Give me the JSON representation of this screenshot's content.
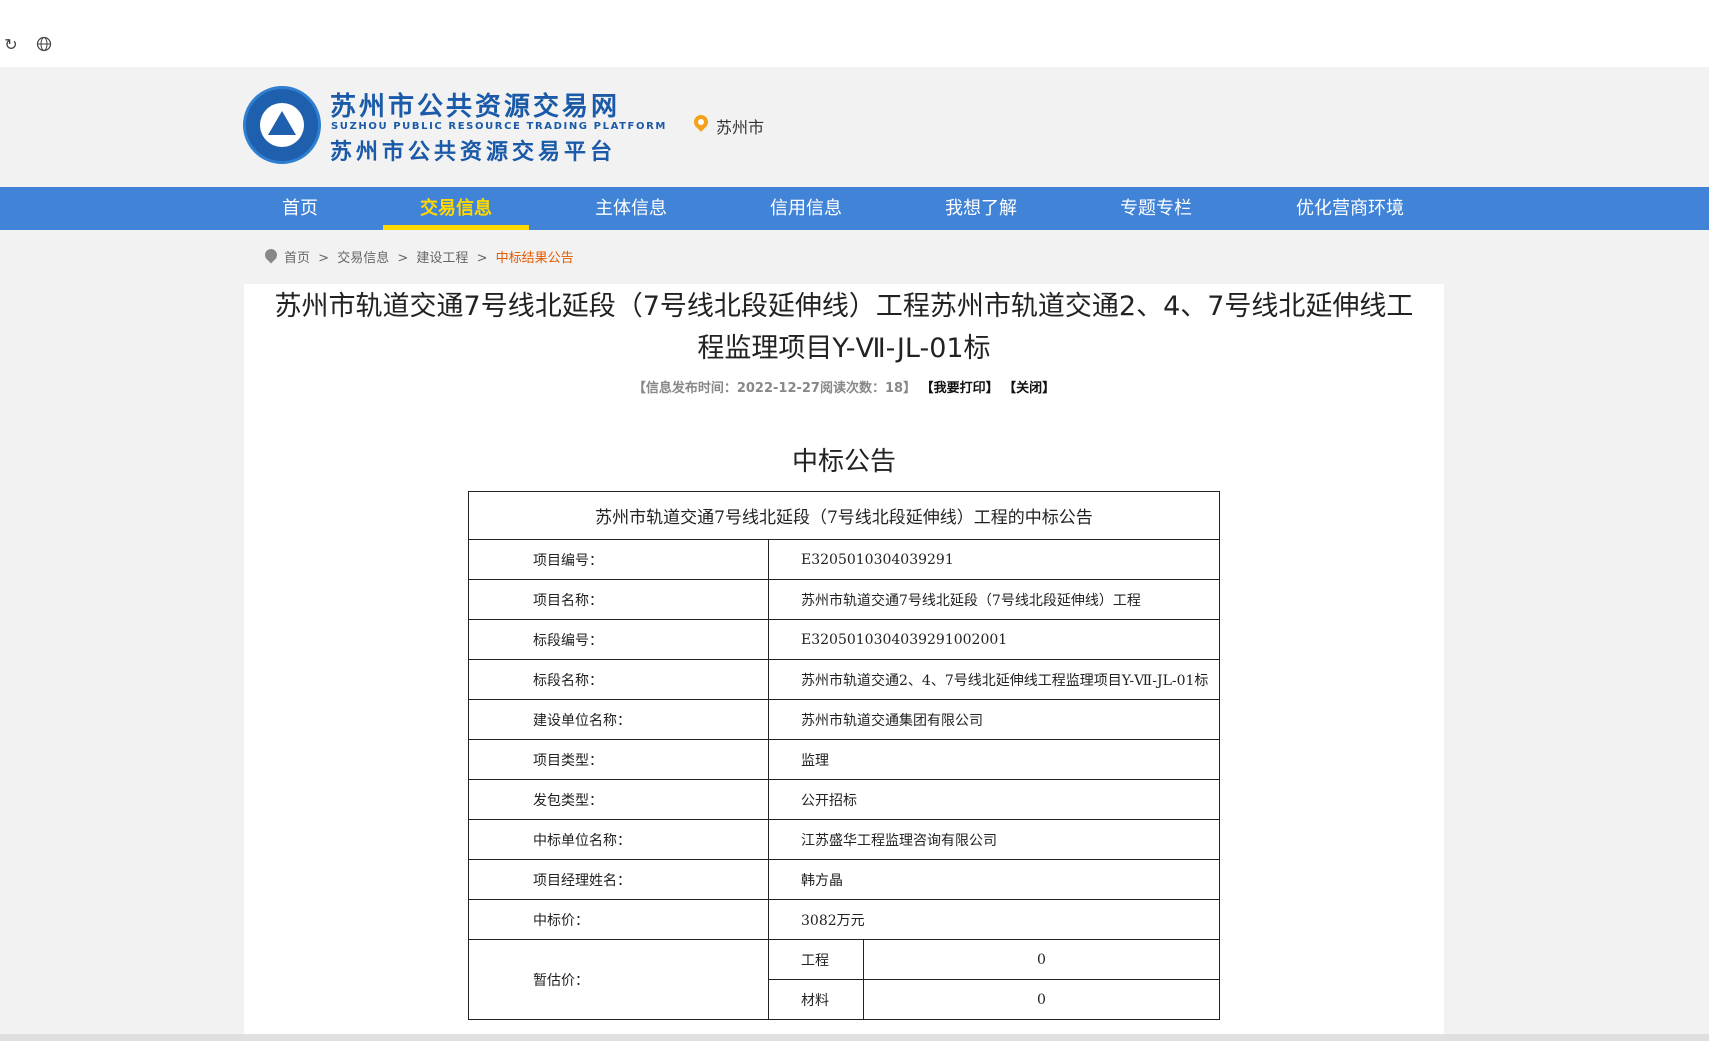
{
  "browser": {
    "refresh_icon": "refresh-icon",
    "globe_icon": "globe-icon"
  },
  "header": {
    "logo_title1": "苏州市公共资源交易网",
    "logo_en": "SUZHOU PUBLIC RESOURCE TRADING PLATFORM",
    "logo_title2": "苏州市公共资源交易平台",
    "location": "苏州市"
  },
  "nav": {
    "items": [
      {
        "label": "首页"
      },
      {
        "label": "交易信息"
      },
      {
        "label": "主体信息"
      },
      {
        "label": "信用信息"
      },
      {
        "label": "我想了解"
      },
      {
        "label": "专题专栏"
      },
      {
        "label": "优化营商环境"
      }
    ],
    "active_index": 1
  },
  "breadcrumb": {
    "items": [
      "首页",
      ">",
      "交易信息",
      ">",
      "建设工程",
      ">",
      "中标结果公告"
    ]
  },
  "article": {
    "title_line1": "苏州市轨道交通7号线北延段（7号线北段延伸线）工程苏州市轨道交通2、4、7号线北延伸线工",
    "title_line2": "程监理项目Y-Ⅶ-JL-01标",
    "meta": "【信息发布时间：2022-12-27阅读次数：18】",
    "print_label": "【我要打印】",
    "close_label": "【关闭】",
    "heading": "中标公告"
  },
  "table": {
    "caption": "苏州市轨道交通7号线北延段（7号线北段延伸线）工程的中标公告",
    "rows": [
      {
        "key": "项目编号：",
        "value": "E3205010304039291"
      },
      {
        "key": "项目名称：",
        "value": "苏州市轨道交通7号线北延段（7号线北段延伸线）工程"
      },
      {
        "key": "标段编号：",
        "value": "E3205010304039291002001"
      },
      {
        "key": "标段名称：",
        "value": "苏州市轨道交通2、4、7号线北延伸线工程监理项目Y-Ⅶ-JL-01标"
      },
      {
        "key": "建设单位名称：",
        "value": "苏州市轨道交通集团有限公司"
      },
      {
        "key": "项目类型：",
        "value": "监理"
      },
      {
        "key": "发包类型：",
        "value": "公开招标"
      },
      {
        "key": "中标单位名称：",
        "value": "江苏盛华工程监理咨询有限公司"
      },
      {
        "key": "项目经理姓名：",
        "value": "韩方晶"
      },
      {
        "key": "中标价：",
        "value": "3082万元"
      }
    ],
    "provisional": {
      "key": "暂估价：",
      "items": [
        {
          "label": "工程",
          "value": "0"
        },
        {
          "label": "材料",
          "value": "0"
        }
      ]
    }
  },
  "colors": {
    "nav_bg": "#4183d7",
    "nav_active": "#ffd800",
    "brand_blue": "#1b5aa8",
    "breadcrumb_current": "#e05a00"
  }
}
